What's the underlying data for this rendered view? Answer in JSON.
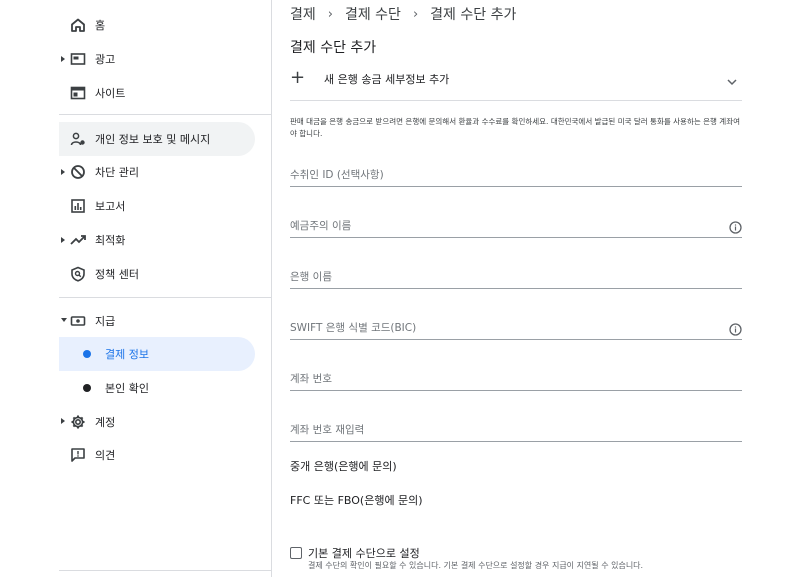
{
  "sidebar": {
    "items": [
      {
        "label": "홈",
        "icon": "home-icon"
      },
      {
        "label": "광고",
        "icon": "ads-icon"
      },
      {
        "label": "사이트",
        "icon": "sites-icon"
      },
      {
        "label": "개인 정보 보호 및 메시지",
        "icon": "privacy-icon"
      },
      {
        "label": "차단 관리",
        "icon": "block-icon"
      },
      {
        "label": "보고서",
        "icon": "reports-icon"
      },
      {
        "label": "최적화",
        "icon": "optimization-icon"
      },
      {
        "label": "정책 센터",
        "icon": "policy-icon"
      },
      {
        "label": "지급",
        "icon": "payments-icon"
      },
      {
        "label": "결제 정보"
      },
      {
        "label": "본인 확인"
      },
      {
        "label": "계정",
        "icon": "gear-icon"
      },
      {
        "label": "의견",
        "icon": "feedback-icon"
      }
    ]
  },
  "breadcrumb": [
    "결제",
    "결제 수단",
    "결제 수단 추가"
  ],
  "page_title": "결제 수단 추가",
  "expander_label": "새 은행 송금 세부정보 추가",
  "info_text": "판매 대금을 은행 송금으로 받으려면 은행에 문의해서 환율과 수수료를 확인하세요. 대한민국에서 발급된 미국 달러 통화를 사용하는 은행 계좌여야 합니다.",
  "fields": {
    "recipient_id": "수취인 ID (선택사항)",
    "account_holder": "예금주의 이름",
    "bank_name": "은행 이름",
    "swift": "SWIFT 은행 식별 코드(BIC)",
    "account_number": "계좌 번호",
    "account_number_confirm": "계좌 번호 재입력"
  },
  "intermediary_bank": "중개 은행(은행에 문의)",
  "ffc": "FFC 또는 FBO(은행에 문의)",
  "default_checkbox": {
    "label": "기본 결제 수단으로 설정",
    "help": "결제 수단의 확인이 필요할 수 있습니다. 기본 결제 수단으로 설정할 경우 지급이 지연될 수 있습니다."
  },
  "colors": {
    "accent": "#1a73e8",
    "active_bg": "#e8f0fe",
    "hover_bg": "#f1f3f4",
    "divider": "#dadce0"
  }
}
